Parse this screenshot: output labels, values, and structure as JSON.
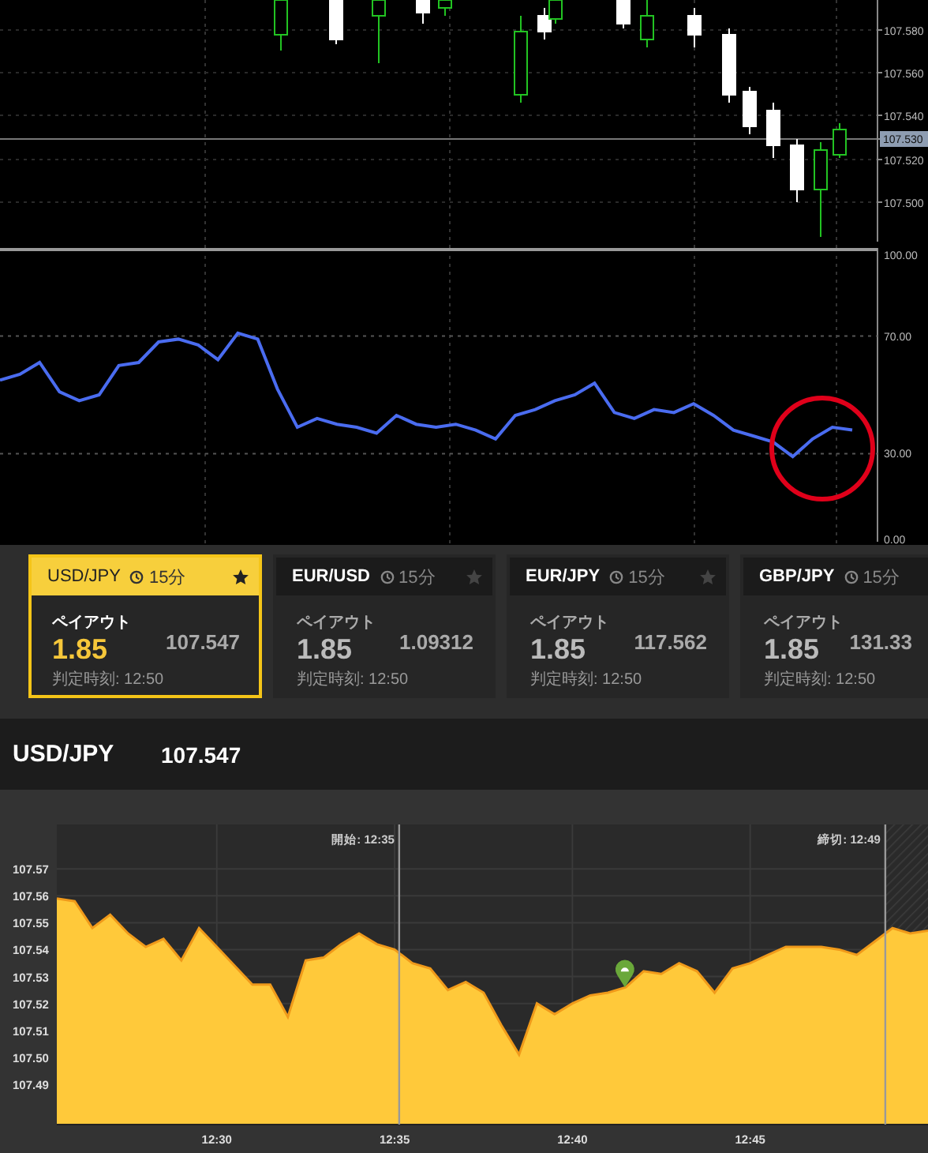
{
  "price_chart": {
    "price_axis": [
      {
        "label": "107.580",
        "current": false
      },
      {
        "label": "107.560",
        "current": false
      },
      {
        "label": "107.540",
        "current": false
      },
      {
        "label": "107.530",
        "current": true
      },
      {
        "label": "107.520",
        "current": false
      },
      {
        "label": "107.500",
        "current": false
      }
    ]
  },
  "rsi": {
    "chart_data": {
      "type": "line",
      "grid": true,
      "ylim": [
        0,
        100
      ],
      "yticks": [
        {
          "value": 100,
          "label": "100.00"
        },
        {
          "value": 70,
          "label": "70.00"
        },
        {
          "value": 30,
          "label": "30.00"
        },
        {
          "value": 0,
          "label": "0.00"
        }
      ],
      "series": [
        {
          "color": "#4a6cf0",
          "values": [
            55,
            57,
            61,
            51,
            48,
            50,
            60,
            61,
            68,
            69,
            67,
            62,
            71,
            69,
            52,
            39,
            42,
            40,
            39,
            37,
            43,
            40,
            39,
            40,
            38,
            35,
            43,
            45,
            48,
            50,
            54,
            44,
            42,
            45,
            44,
            47,
            43,
            38,
            36,
            34,
            29,
            35,
            39,
            38
          ]
        }
      ]
    }
  },
  "cards": [
    {
      "pair": "USD/JPY",
      "period": "15分",
      "payout_label": "ペイアウト",
      "payout": "1.85",
      "price": "107.547",
      "expiry": "判定時刻: 12:50",
      "selected": true
    },
    {
      "pair": "EUR/USD",
      "period": "15分",
      "payout_label": "ペイアウト",
      "payout": "1.85",
      "price": "1.09312",
      "expiry": "判定時刻: 12:50",
      "selected": false
    },
    {
      "pair": "EUR/JPY",
      "period": "15分",
      "payout_label": "ペイアウト",
      "payout": "1.85",
      "price": "117.562",
      "expiry": "判定時刻: 12:50",
      "selected": false
    },
    {
      "pair": "GBP/JPY",
      "period": "15分",
      "payout_label": "ペイアウト",
      "payout": "1.85",
      "price": "131.33",
      "expiry": "判定時刻: 12:50",
      "selected": false
    }
  ],
  "quote_bar": {
    "pair": "USD/JPY",
    "price": "107.547"
  },
  "price_area": {
    "time_markers": [
      {
        "label": "開始: 12:35"
      },
      {
        "label": "締切: 12:49"
      }
    ],
    "chart_data": {
      "type": "area",
      "grid": true,
      "ylim": [
        107.475,
        107.5865
      ],
      "yticks": [
        {
          "value": 107.57,
          "label": "107.57"
        },
        {
          "value": 107.56,
          "label": "107.56"
        },
        {
          "value": 107.55,
          "label": "107.55"
        },
        {
          "value": 107.54,
          "label": "107.54"
        },
        {
          "value": 107.53,
          "label": "107.53"
        },
        {
          "value": 107.52,
          "label": "107.52"
        },
        {
          "value": 107.51,
          "label": "107.51"
        },
        {
          "value": 107.5,
          "label": "107.50"
        },
        {
          "value": 107.49,
          "label": "107.49"
        }
      ],
      "categories": [
        null,
        null,
        null,
        null,
        null,
        null,
        null,
        null,
        null,
        "12:30",
        null,
        null,
        null,
        null,
        null,
        null,
        null,
        null,
        null,
        "12:35",
        null,
        null,
        null,
        null,
        null,
        null,
        null,
        null,
        null,
        "12:40",
        null,
        null,
        null,
        null,
        null,
        null,
        null,
        null,
        null,
        "12:45",
        null,
        null,
        null,
        null,
        null,
        null,
        null,
        null,
        null,
        null
      ],
      "series": [
        {
          "color": "#ffc93a",
          "values": [
            107.559,
            107.558,
            107.548,
            107.553,
            107.546,
            107.541,
            107.544,
            107.536,
            107.548,
            107.541,
            107.534,
            107.527,
            107.527,
            107.515,
            107.536,
            107.537,
            107.542,
            107.546,
            107.542,
            107.54,
            107.535,
            107.533,
            107.525,
            107.528,
            107.524,
            107.512,
            107.501,
            107.52,
            107.516,
            107.52,
            107.523,
            107.524,
            107.526,
            107.532,
            107.531,
            107.535,
            107.532,
            107.524,
            107.533,
            107.535,
            107.538,
            107.541,
            107.541,
            107.541,
            107.54,
            107.538,
            107.543,
            107.548,
            107.546,
            107.547
          ]
        }
      ]
    }
  }
}
